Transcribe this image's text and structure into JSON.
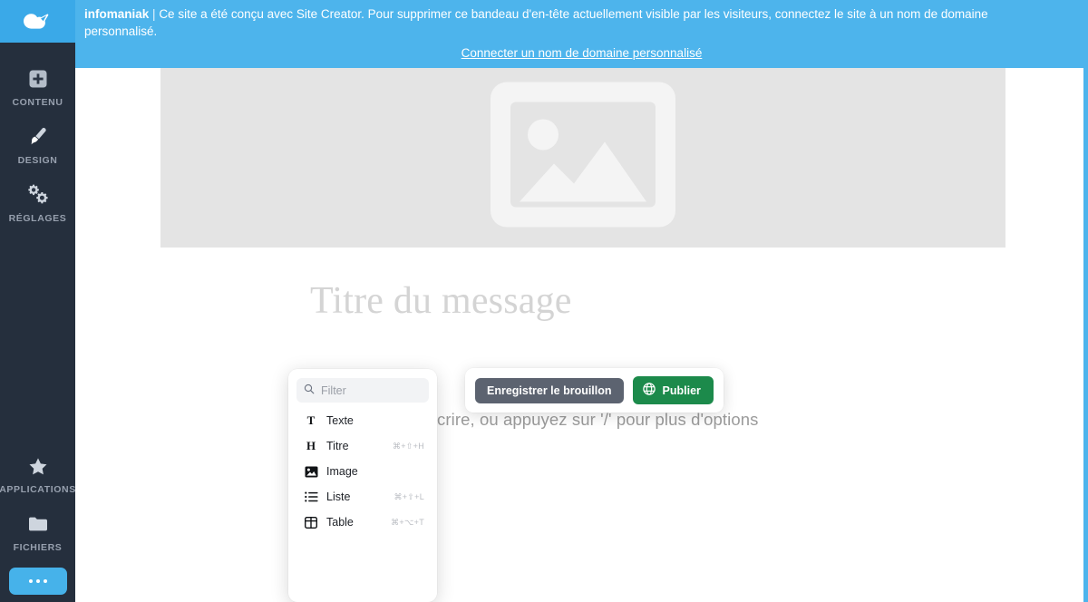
{
  "sidebar": {
    "logo_name": "infomaniak-cloud-logo",
    "top_items": [
      {
        "label": "CONTENU",
        "icon": "plus-square-icon"
      },
      {
        "label": "DESIGN",
        "icon": "paintbrush-icon"
      },
      {
        "label": "RÉGLAGES",
        "icon": "gears-icon"
      }
    ],
    "bottom_items": [
      {
        "label": "APPLICATIONS",
        "icon": "star-icon"
      },
      {
        "label": "FICHIERS",
        "icon": "folder-icon"
      }
    ],
    "more_label": "•••"
  },
  "banner": {
    "brand": "infomaniak",
    "separator": "|",
    "message": "Ce site a été conçu avec Site Creator. Pour supprimer ce bandeau d'en-tête actuellement visible par les visiteurs, connectez le site à un nom de domaine personnalisé.",
    "link_label": "Connecter un nom de domaine personnalisé",
    "background_color": "#4db4ec"
  },
  "page": {
    "hero_image_placeholder_icon": "image-placeholder-icon",
    "post_title": "Titre du message",
    "editor_add_icon": "plus-icon",
    "editor_placeholder": "Commencez à écrire, ou appuyez sur '/' pour plus d'options"
  },
  "slash_menu": {
    "filter_placeholder": "Filter",
    "filter_value": "",
    "search_icon": "search-icon",
    "items": [
      {
        "label": "Texte",
        "icon": "text-icon",
        "shortcut": ""
      },
      {
        "label": "Titre",
        "icon": "heading-icon",
        "shortcut": "⌘+⇧+H"
      },
      {
        "label": "Image",
        "icon": "image-icon",
        "shortcut": ""
      },
      {
        "label": "Liste",
        "icon": "list-icon",
        "shortcut": "⌘+⇧+L"
      },
      {
        "label": "Table",
        "icon": "table-icon",
        "shortcut": "⌘+⌥+T"
      }
    ]
  },
  "action_bar": {
    "draft_label": "Enregistrer le brouillon",
    "publish_label": "Publier",
    "publish_icon": "globe-icon",
    "draft_color": "#5c6370",
    "publish_color": "#1c8a4b"
  }
}
